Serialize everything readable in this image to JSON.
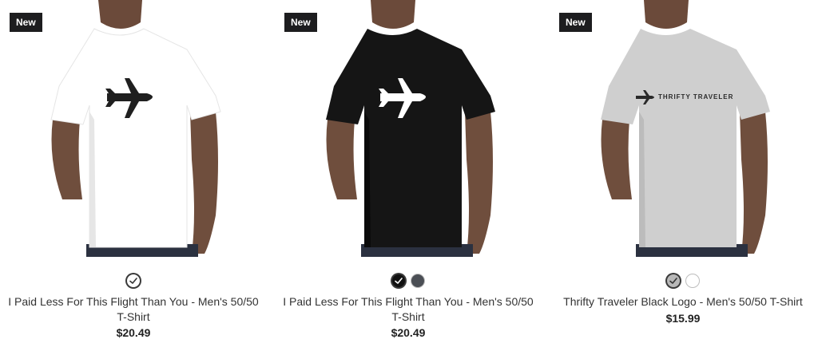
{
  "products": [
    {
      "badge": "New",
      "shirt_color": "#ffffff",
      "shirt_shadow": "#e6e6e6",
      "logo_color": "#1f1f1f",
      "logo_text": "",
      "title": "I Paid Less For This Flight Than You - Men's 50/50 T-Shirt",
      "price": "$20.49",
      "swatches": [
        {
          "name": "white",
          "color": "#ffffff",
          "selected": true
        }
      ]
    },
    {
      "badge": "New",
      "shirt_color": "#151515",
      "shirt_shadow": "#0a0a0a",
      "logo_color": "#ffffff",
      "logo_text": "",
      "title": "I Paid Less For This Flight Than You - Men's 50/50 T-Shirt",
      "price": "$20.49",
      "swatches": [
        {
          "name": "black",
          "color": "#111111",
          "selected": true
        },
        {
          "name": "charcoal",
          "color": "#4b4f55",
          "selected": false
        }
      ]
    },
    {
      "badge": "New",
      "shirt_color": "#cfcfcf",
      "shirt_shadow": "#bcbcbc",
      "logo_color": "#2a2a2a",
      "logo_text": "THRIFTY TRAVELER",
      "title": "Thrifty Traveler Black Logo - Men's 50/50 T-Shirt",
      "price": "$15.99",
      "swatches": [
        {
          "name": "heather-gray",
          "color": "#b8b8b8",
          "selected": true
        },
        {
          "name": "white",
          "color": "#ffffff",
          "selected": false
        }
      ]
    }
  ]
}
